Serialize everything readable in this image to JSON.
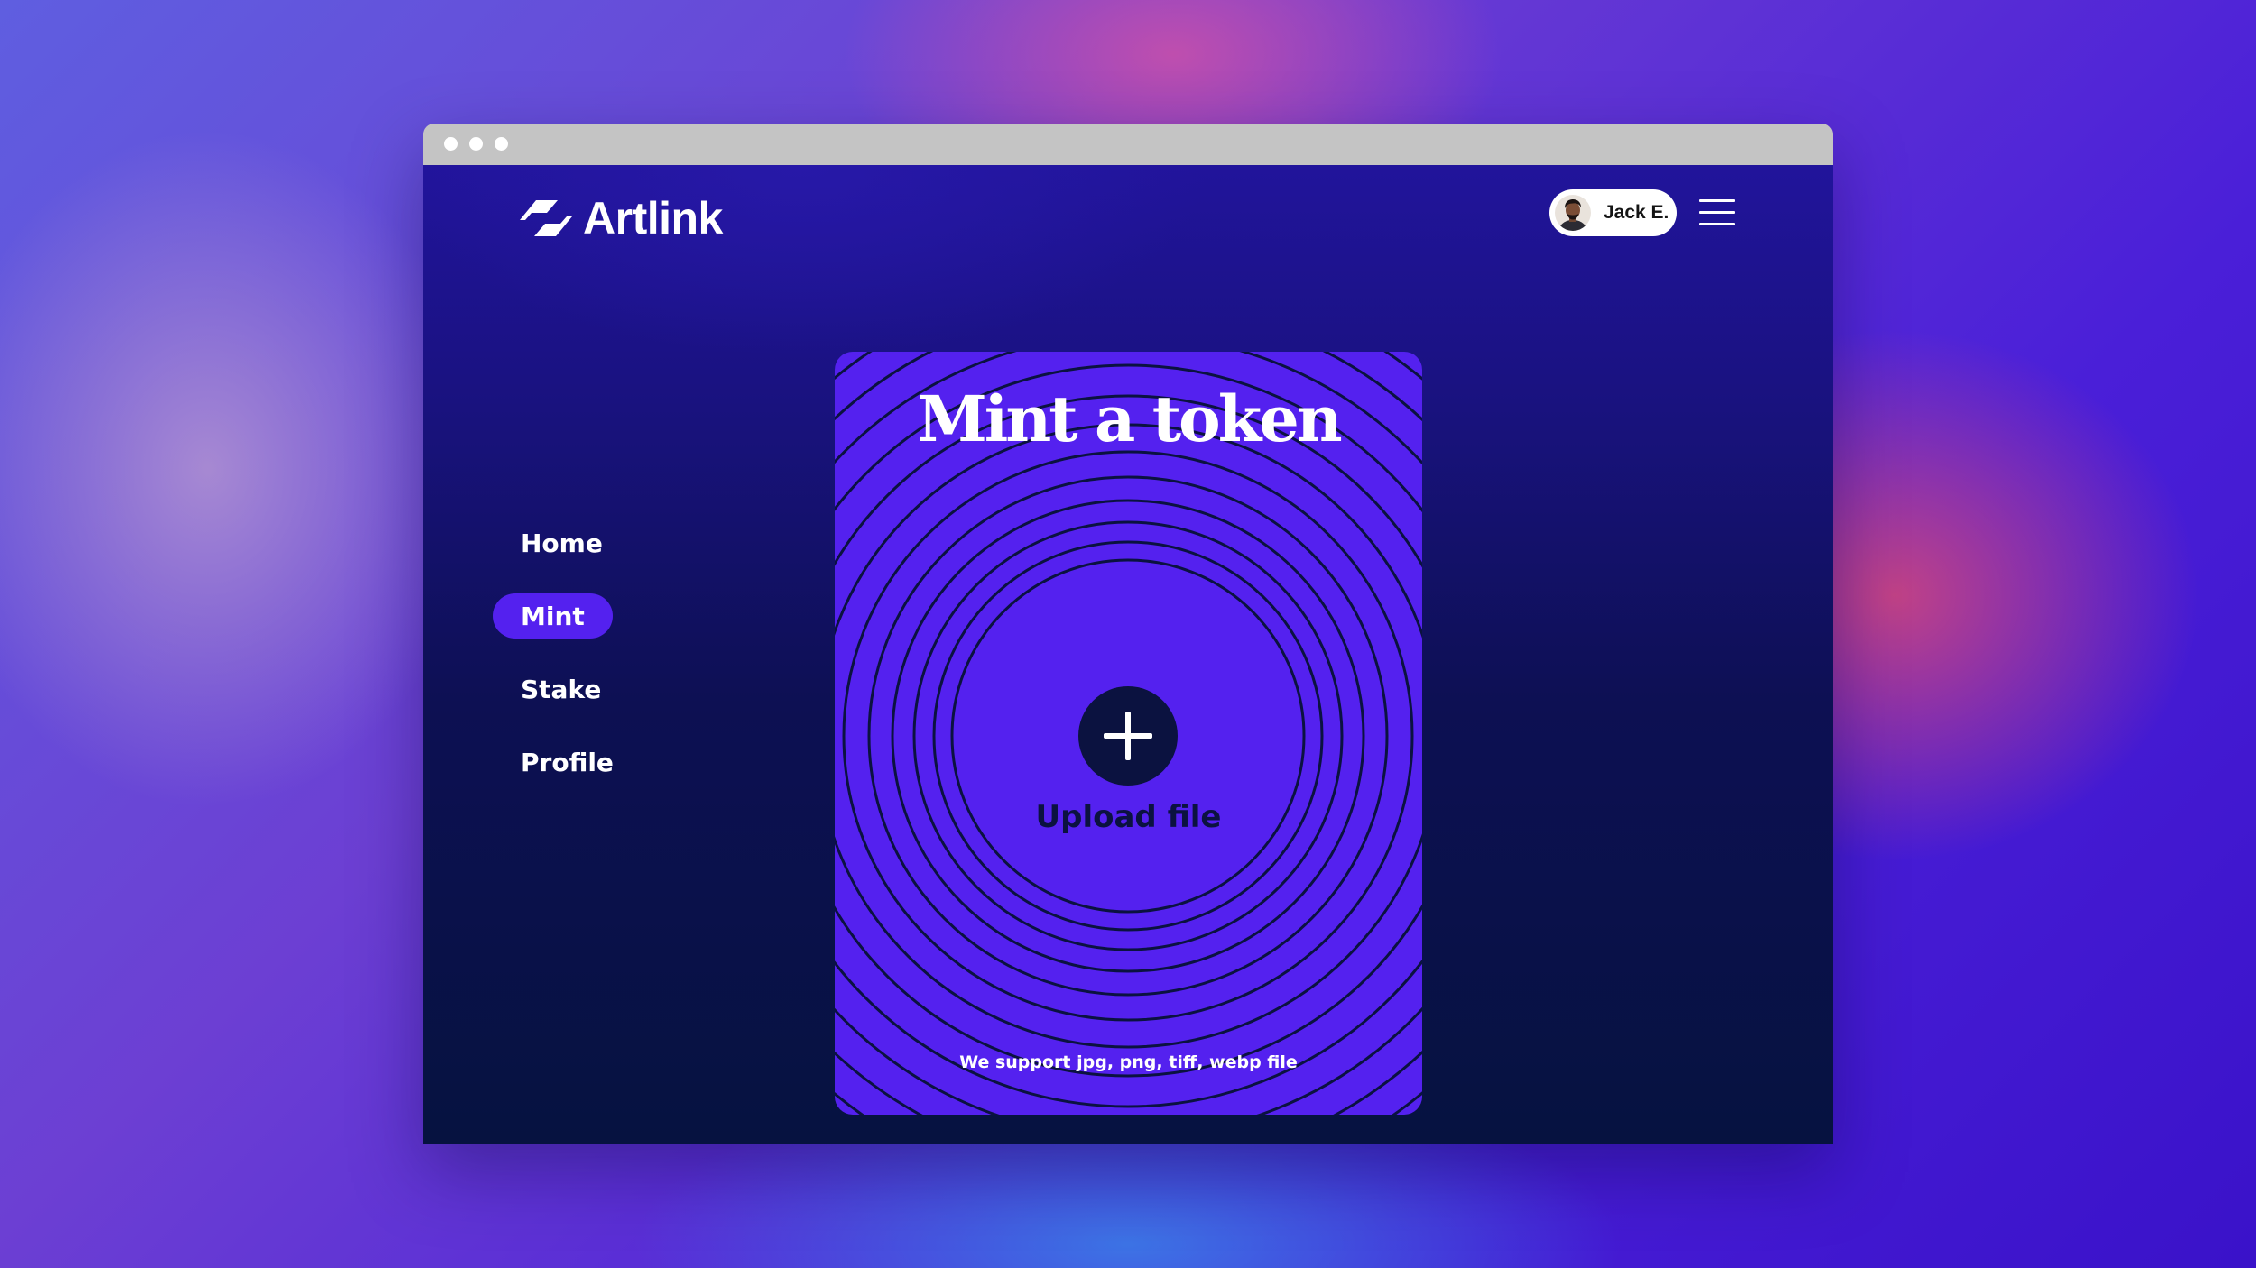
{
  "brand": {
    "name": "Artlink",
    "logo_icon": "artlink-logo-icon"
  },
  "user": {
    "name": "Jack E.",
    "avatar_icon": "user-avatar"
  },
  "menu_icon": "hamburger-menu-icon",
  "sidebar": {
    "items": [
      {
        "label": "Home",
        "active": false
      },
      {
        "label": "Mint",
        "active": true
      },
      {
        "label": "Stake",
        "active": false
      },
      {
        "label": "Profile",
        "active": false
      }
    ]
  },
  "mint_card": {
    "title": "Mint a token",
    "upload_label": "Upload file",
    "upload_icon": "plus-icon",
    "support_note": "We support jpg, png, tiff, webp file"
  },
  "colors": {
    "accent": "#5421ef",
    "app_background_top": "#21149b",
    "app_background_bottom": "#061240",
    "window_bar": "#c4c4c4",
    "text_light": "#ffffff",
    "text_dark": "#0b1240",
    "ring_stroke": "#0b1240"
  }
}
